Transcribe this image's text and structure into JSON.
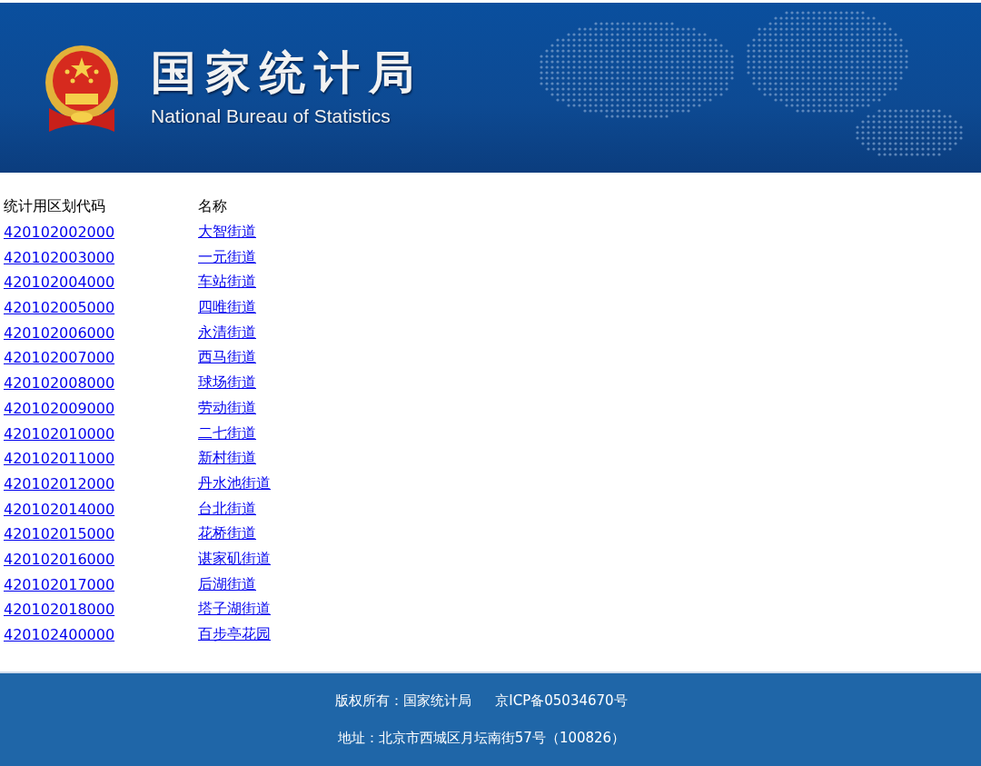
{
  "header": {
    "title": "国家统计局",
    "subtitle": "National Bureau of Statistics"
  },
  "table": {
    "columns": [
      "统计用区划代码",
      "名称"
    ],
    "rows": [
      {
        "code": "420102002000",
        "name": "大智街道"
      },
      {
        "code": "420102003000",
        "name": "一元街道"
      },
      {
        "code": "420102004000",
        "name": "车站街道"
      },
      {
        "code": "420102005000",
        "name": "四唯街道"
      },
      {
        "code": "420102006000",
        "name": "永清街道"
      },
      {
        "code": "420102007000",
        "name": "西马街道"
      },
      {
        "code": "420102008000",
        "name": "球场街道"
      },
      {
        "code": "420102009000",
        "name": "劳动街道"
      },
      {
        "code": "420102010000",
        "name": "二七街道"
      },
      {
        "code": "420102011000",
        "name": "新村街道"
      },
      {
        "code": "420102012000",
        "name": "丹水池街道"
      },
      {
        "code": "420102014000",
        "name": "台北街道"
      },
      {
        "code": "420102015000",
        "name": "花桥街道"
      },
      {
        "code": "420102016000",
        "name": "谌家矶街道"
      },
      {
        "code": "420102017000",
        "name": "后湖街道"
      },
      {
        "code": "420102018000",
        "name": "塔子湖街道"
      },
      {
        "code": "420102400000",
        "name": "百步亭花园"
      }
    ]
  },
  "footer": {
    "copyright": "版权所有：国家统计局",
    "icp": "京ICP备05034670号",
    "address": "地址：北京市西城区月坛南街57号（100826）"
  }
}
